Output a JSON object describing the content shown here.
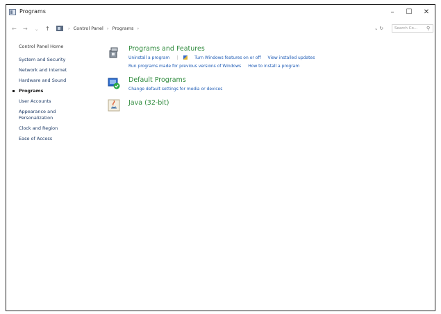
{
  "window": {
    "title": "Programs",
    "minimize": "–",
    "maximize": "☐",
    "close": "✕"
  },
  "address": {
    "back": "←",
    "forward": "→",
    "dropdown": "⌄",
    "up": "↑",
    "breadcrumbs": [
      "Control Panel",
      "Programs"
    ],
    "refresh": "⌄ ↻",
    "search_placeholder": "Search Co..."
  },
  "sidebar": {
    "items": [
      {
        "label": "Control Panel Home"
      },
      {
        "label": "System and Security"
      },
      {
        "label": "Network and Internet"
      },
      {
        "label": "Hardware and Sound"
      },
      {
        "label": "Programs"
      },
      {
        "label": "User Accounts"
      },
      {
        "label": "Appearance and Personalization"
      },
      {
        "label": "Clock and Region"
      },
      {
        "label": "Ease of Access"
      }
    ]
  },
  "main": {
    "programs_features": {
      "title": "Programs and Features",
      "links": [
        "Uninstall a program",
        "Turn Windows features on or off",
        "View installed updates",
        "Run programs made for previous versions of Windows",
        "How to install a program"
      ]
    },
    "default_programs": {
      "title": "Default Programs",
      "links": [
        "Change default settings for media or devices"
      ]
    },
    "java": {
      "title": "Java (32-bit)"
    }
  }
}
